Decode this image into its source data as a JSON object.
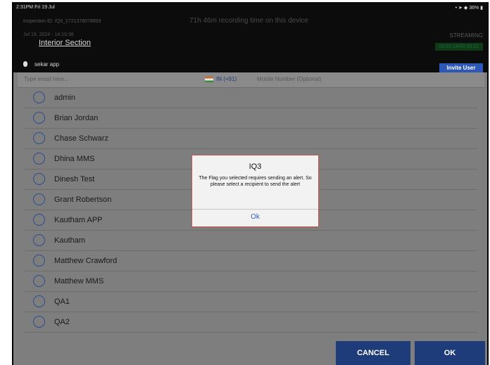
{
  "status_bar": {
    "time": "2:31PM  Fri 19 Jul",
    "indicators": "• ➤ ◆ 36% ▮"
  },
  "header": {
    "inspection_id": "Inspection ID: IQ3_1721378078893",
    "recording_time": "71h 46m recording time on this device",
    "datetime": "Jul 19, 2024 - 14:19:38",
    "section_title": "Interior Section",
    "streaming_label": "STREAMING",
    "timer": "00:01:14/00:58:21"
  },
  "user_row": {
    "app_name": "sekar app",
    "invite_button": "Invite User"
  },
  "inputs": {
    "email_placeholder": "Type email here...",
    "country_code": "IN (+91)",
    "mobile_placeholder": "Mobile Number (Optional)"
  },
  "recipients": [
    {
      "name": "admin"
    },
    {
      "name": "Brian Jordan"
    },
    {
      "name": "Chase Schwarz"
    },
    {
      "name": "Dhina MMS"
    },
    {
      "name": "Dinesh Test"
    },
    {
      "name": "Grant Robertson"
    },
    {
      "name": "Kautham APP"
    },
    {
      "name": "Kautham"
    },
    {
      "name": "Matthew Crawford"
    },
    {
      "name": "Matthew MMS"
    },
    {
      "name": "QA1"
    },
    {
      "name": "QA2"
    }
  ],
  "footer": {
    "cancel_label": "CANCEL",
    "ok_label": "OK"
  },
  "dialog": {
    "title": "IQ3",
    "message": "The Flag you selected requires sending an alert. So please select a recipient to send the alert",
    "ok_label": "Ok"
  },
  "colors": {
    "accent": "#1f3c7a",
    "dialog_border": "#d05050",
    "link": "#2e5fb8"
  }
}
